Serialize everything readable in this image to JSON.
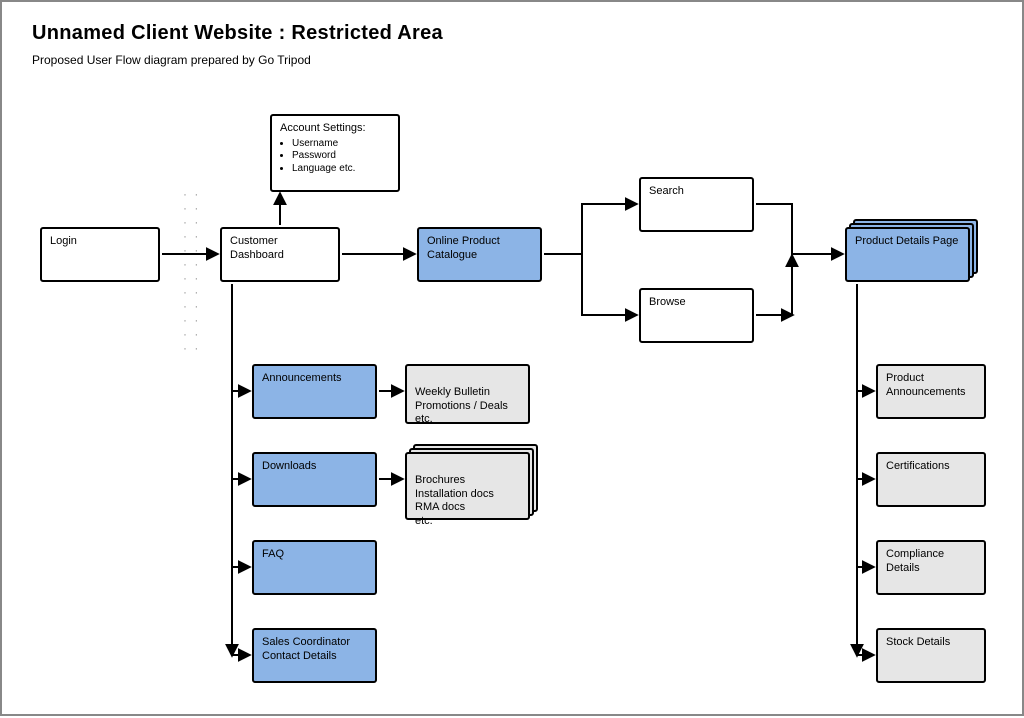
{
  "header": {
    "title": "Unnamed Client Website : Restricted Area",
    "subtitle": "Proposed User Flow diagram prepared by Go Tripod"
  },
  "boxes": {
    "login": "Login",
    "customer_dashboard": "Customer Dashboard",
    "account_settings_title": "Account Settings:",
    "account_settings_items": [
      "Username",
      "Password",
      "Language etc."
    ],
    "catalogue": "Online Product Catalogue",
    "search": "Search",
    "browse": "Browse",
    "product_details": "Product Details Page",
    "announcements": "Announcements",
    "downloads": "Downloads",
    "faq": "FAQ",
    "sales_coordinator": "Sales Coordinator Contact Details",
    "weekly_bulletin": "Weekly Bulletin\nPromotions / Deals\netc.",
    "brochures": "Brochures\nInstallation docs\nRMA docs\netc.",
    "product_announcements": "Product Announcements",
    "certifications": "Certifications",
    "compliance": "Compliance Details",
    "stock": "Stock Details"
  },
  "colors": {
    "blue": "#8cb4e6",
    "gray": "#e6e6e6"
  }
}
